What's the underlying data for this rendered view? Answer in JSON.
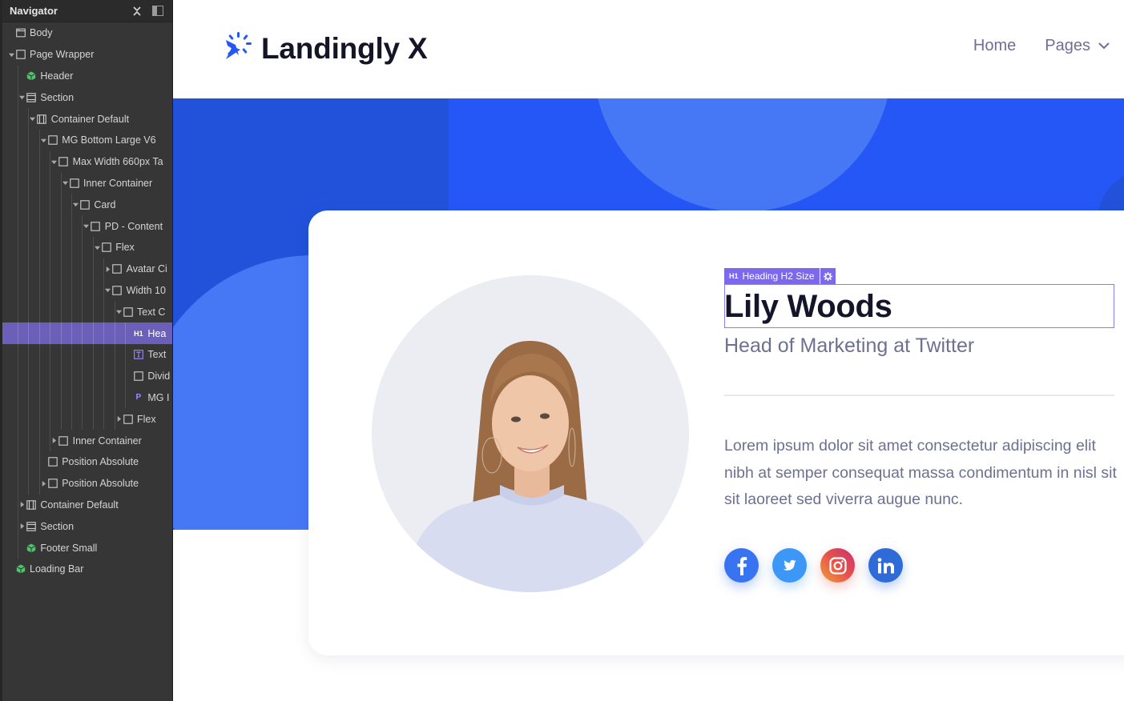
{
  "navigator": {
    "title": "Navigator",
    "close_icon": "close-icon",
    "dock_icon": "dock-panel-icon",
    "items": [
      {
        "label": "Body",
        "depth": 0,
        "caret": "none",
        "icon": "body-icon"
      },
      {
        "label": "Page Wrapper",
        "depth": 0,
        "caret": "open",
        "icon": "box-icon"
      },
      {
        "label": "Header",
        "depth": 1,
        "caret": "none",
        "icon": "component-icon"
      },
      {
        "label": "Section",
        "depth": 1,
        "caret": "open",
        "icon": "section-icon"
      },
      {
        "label": "Container Default",
        "depth": 2,
        "caret": "open",
        "icon": "container-icon"
      },
      {
        "label": "MG Bottom Large V6",
        "depth": 3,
        "caret": "open",
        "icon": "box-icon"
      },
      {
        "label": "Max Width 660px Ta",
        "depth": 4,
        "caret": "open",
        "icon": "box-icon"
      },
      {
        "label": "Inner Container",
        "depth": 5,
        "caret": "open",
        "icon": "box-icon"
      },
      {
        "label": "Card",
        "depth": 6,
        "caret": "open",
        "icon": "box-icon"
      },
      {
        "label": "PD - Content",
        "depth": 7,
        "caret": "open",
        "icon": "box-icon"
      },
      {
        "label": "Flex",
        "depth": 8,
        "caret": "open",
        "icon": "box-icon"
      },
      {
        "label": "Avatar Ci",
        "depth": 9,
        "caret": "closed",
        "icon": "box-icon"
      },
      {
        "label": "Width 10",
        "depth": 9,
        "caret": "open",
        "icon": "box-icon"
      },
      {
        "label": "Text C",
        "depth": 10,
        "caret": "open",
        "icon": "box-icon"
      },
      {
        "label": "Hea",
        "depth": 11,
        "caret": "none",
        "icon": "heading-icon",
        "selected": true
      },
      {
        "label": "Text",
        "depth": 11,
        "caret": "none",
        "icon": "text-icon"
      },
      {
        "label": "Divid",
        "depth": 11,
        "caret": "none",
        "icon": "box-icon"
      },
      {
        "label": "MG I",
        "depth": 11,
        "caret": "none",
        "icon": "paragraph-icon"
      },
      {
        "label": "Flex",
        "depth": 10,
        "caret": "closed",
        "icon": "box-icon"
      },
      {
        "label": "Inner Container",
        "depth": 4,
        "caret": "closed",
        "icon": "box-icon"
      },
      {
        "label": "Position Absolute",
        "depth": 3,
        "caret": "none",
        "icon": "box-icon"
      },
      {
        "label": "Position Absolute",
        "depth": 3,
        "caret": "closed",
        "icon": "box-icon"
      },
      {
        "label": "Container Default",
        "depth": 1,
        "caret": "closed",
        "icon": "container-icon"
      },
      {
        "label": "Section",
        "depth": 1,
        "caret": "closed",
        "icon": "section-icon"
      },
      {
        "label": "Footer Small",
        "depth": 1,
        "caret": "none",
        "icon": "component-icon"
      },
      {
        "label": "Loading Bar",
        "depth": 0,
        "caret": "none",
        "icon": "component-icon"
      }
    ]
  },
  "site": {
    "logo_text": "Landingly X",
    "nav": {
      "home": "Home",
      "pages": "Pages"
    }
  },
  "card": {
    "selection_tag": {
      "tag": "H1",
      "label": "Heading H2 Size"
    },
    "name": "Lily Woods",
    "role": "Head of Marketing at Twitter",
    "bio": "Lorem ipsum dolor sit amet consectetur adipiscing elit nibh at semper consequat massa condimentum in nisl sit sit laoreet sed viverra augue nunc.",
    "socials": [
      {
        "name": "facebook",
        "icon": "facebook-icon"
      },
      {
        "name": "twitter",
        "icon": "twitter-icon"
      },
      {
        "name": "instagram",
        "icon": "instagram-icon"
      },
      {
        "name": "linkedin",
        "icon": "linkedin-icon"
      }
    ]
  },
  "colors": {
    "brand_blue": "#2457f5",
    "selection_purple": "#7b68ee",
    "component_green": "#4cc46a"
  }
}
